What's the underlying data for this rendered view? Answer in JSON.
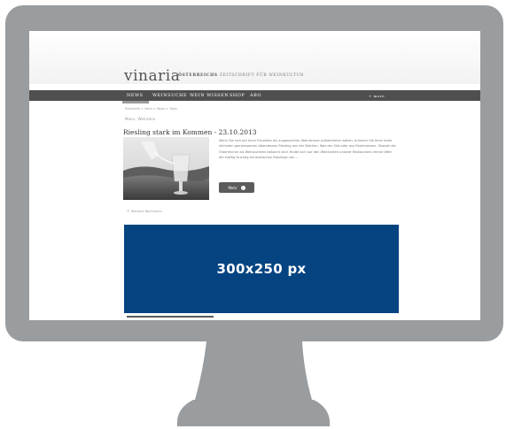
{
  "site": {
    "logo": "vinaria",
    "tagline_bold": "ÖSTERREICHS",
    "tagline_rest": "ZEITSCHRIFT FÜR WEINKULTUR"
  },
  "nav": {
    "items": [
      "NEWS",
      "WEINSUCHE",
      "WEIN WISSEN",
      "SHOP",
      "ABO"
    ],
    "right": "+ more"
  },
  "breadcrumb": "Startseite > Wein > News > Topic",
  "menu_line": "Menu · Weinzone",
  "article": {
    "title": "Riesling stark im Kommen - 23.10.2013",
    "body": "Wenn Sie sich bei Ihren Freunden als ausgesuchter Weinkenner präsentieren wollen, erinnern Sie Ihren beim nächsten gemeinsamen Abendessen Riesling aus der Wachau. Was der Süd oder aus Rheinhessen. Obwohl die Österreicher als Weinpuristen bekannt sind, findet sich auf den Weinkarten unserer Restaurants immer öfter die kräftig-fruchtig-mineralischen Rieslinge von ...",
    "more_button": "Mehr",
    "author": "© Romana Bachmann"
  },
  "ad": {
    "label": "300x250 px",
    "color": "#054481"
  }
}
